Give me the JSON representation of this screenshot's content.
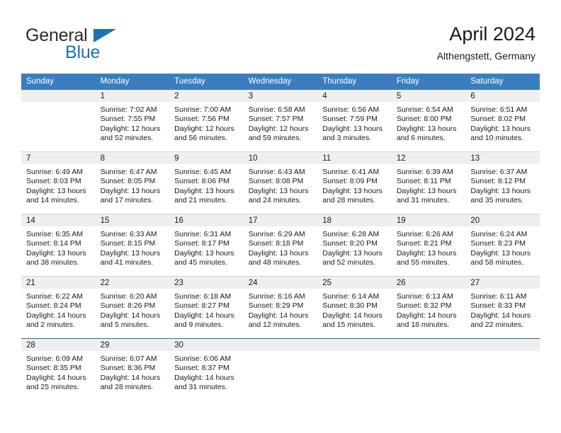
{
  "logo": {
    "word_one": "General",
    "word_two": "Blue",
    "triangle_color": "#1a71b8"
  },
  "header": {
    "month_title": "April 2024",
    "location": "Althengstett, Germany"
  },
  "theme": {
    "header_blue": "#3a7ebf",
    "band_gray": "#efefef",
    "separator_gray": "#d2d2d2",
    "separator_blue": "#2a6ca8"
  },
  "weekday_headers": [
    "Sunday",
    "Monday",
    "Tuesday",
    "Wednesday",
    "Thursday",
    "Friday",
    "Saturday"
  ],
  "weeks": [
    [
      {
        "day": "",
        "sunrise": "",
        "sunset": "",
        "daylight_line1": "",
        "daylight_line2": "",
        "empty": true
      },
      {
        "day": "1",
        "sunrise": "Sunrise: 7:02 AM",
        "sunset": "Sunset: 7:55 PM",
        "daylight_line1": "Daylight: 12 hours",
        "daylight_line2": "and 52 minutes."
      },
      {
        "day": "2",
        "sunrise": "Sunrise: 7:00 AM",
        "sunset": "Sunset: 7:56 PM",
        "daylight_line1": "Daylight: 12 hours",
        "daylight_line2": "and 56 minutes."
      },
      {
        "day": "3",
        "sunrise": "Sunrise: 6:58 AM",
        "sunset": "Sunset: 7:57 PM",
        "daylight_line1": "Daylight: 12 hours",
        "daylight_line2": "and 59 minutes."
      },
      {
        "day": "4",
        "sunrise": "Sunrise: 6:56 AM",
        "sunset": "Sunset: 7:59 PM",
        "daylight_line1": "Daylight: 13 hours",
        "daylight_line2": "and 3 minutes."
      },
      {
        "day": "5",
        "sunrise": "Sunrise: 6:54 AM",
        "sunset": "Sunset: 8:00 PM",
        "daylight_line1": "Daylight: 13 hours",
        "daylight_line2": "and 6 minutes."
      },
      {
        "day": "6",
        "sunrise": "Sunrise: 6:51 AM",
        "sunset": "Sunset: 8:02 PM",
        "daylight_line1": "Daylight: 13 hours",
        "daylight_line2": "and 10 minutes."
      }
    ],
    [
      {
        "day": "7",
        "sunrise": "Sunrise: 6:49 AM",
        "sunset": "Sunset: 8:03 PM",
        "daylight_line1": "Daylight: 13 hours",
        "daylight_line2": "and 14 minutes."
      },
      {
        "day": "8",
        "sunrise": "Sunrise: 6:47 AM",
        "sunset": "Sunset: 8:05 PM",
        "daylight_line1": "Daylight: 13 hours",
        "daylight_line2": "and 17 minutes."
      },
      {
        "day": "9",
        "sunrise": "Sunrise: 6:45 AM",
        "sunset": "Sunset: 8:06 PM",
        "daylight_line1": "Daylight: 13 hours",
        "daylight_line2": "and 21 minutes."
      },
      {
        "day": "10",
        "sunrise": "Sunrise: 6:43 AM",
        "sunset": "Sunset: 8:08 PM",
        "daylight_line1": "Daylight: 13 hours",
        "daylight_line2": "and 24 minutes."
      },
      {
        "day": "11",
        "sunrise": "Sunrise: 6:41 AM",
        "sunset": "Sunset: 8:09 PM",
        "daylight_line1": "Daylight: 13 hours",
        "daylight_line2": "and 28 minutes."
      },
      {
        "day": "12",
        "sunrise": "Sunrise: 6:39 AM",
        "sunset": "Sunset: 8:11 PM",
        "daylight_line1": "Daylight: 13 hours",
        "daylight_line2": "and 31 minutes."
      },
      {
        "day": "13",
        "sunrise": "Sunrise: 6:37 AM",
        "sunset": "Sunset: 8:12 PM",
        "daylight_line1": "Daylight: 13 hours",
        "daylight_line2": "and 35 minutes."
      }
    ],
    [
      {
        "day": "14",
        "sunrise": "Sunrise: 6:35 AM",
        "sunset": "Sunset: 8:14 PM",
        "daylight_line1": "Daylight: 13 hours",
        "daylight_line2": "and 38 minutes."
      },
      {
        "day": "15",
        "sunrise": "Sunrise: 6:33 AM",
        "sunset": "Sunset: 8:15 PM",
        "daylight_line1": "Daylight: 13 hours",
        "daylight_line2": "and 41 minutes."
      },
      {
        "day": "16",
        "sunrise": "Sunrise: 6:31 AM",
        "sunset": "Sunset: 8:17 PM",
        "daylight_line1": "Daylight: 13 hours",
        "daylight_line2": "and 45 minutes."
      },
      {
        "day": "17",
        "sunrise": "Sunrise: 6:29 AM",
        "sunset": "Sunset: 8:18 PM",
        "daylight_line1": "Daylight: 13 hours",
        "daylight_line2": "and 48 minutes."
      },
      {
        "day": "18",
        "sunrise": "Sunrise: 6:28 AM",
        "sunset": "Sunset: 8:20 PM",
        "daylight_line1": "Daylight: 13 hours",
        "daylight_line2": "and 52 minutes."
      },
      {
        "day": "19",
        "sunrise": "Sunrise: 6:26 AM",
        "sunset": "Sunset: 8:21 PM",
        "daylight_line1": "Daylight: 13 hours",
        "daylight_line2": "and 55 minutes."
      },
      {
        "day": "20",
        "sunrise": "Sunrise: 6:24 AM",
        "sunset": "Sunset: 8:23 PM",
        "daylight_line1": "Daylight: 13 hours",
        "daylight_line2": "and 58 minutes."
      }
    ],
    [
      {
        "day": "21",
        "sunrise": "Sunrise: 6:22 AM",
        "sunset": "Sunset: 8:24 PM",
        "daylight_line1": "Daylight: 14 hours",
        "daylight_line2": "and 2 minutes."
      },
      {
        "day": "22",
        "sunrise": "Sunrise: 6:20 AM",
        "sunset": "Sunset: 8:26 PM",
        "daylight_line1": "Daylight: 14 hours",
        "daylight_line2": "and 5 minutes."
      },
      {
        "day": "23",
        "sunrise": "Sunrise: 6:18 AM",
        "sunset": "Sunset: 8:27 PM",
        "daylight_line1": "Daylight: 14 hours",
        "daylight_line2": "and 9 minutes."
      },
      {
        "day": "24",
        "sunrise": "Sunrise: 6:16 AM",
        "sunset": "Sunset: 8:29 PM",
        "daylight_line1": "Daylight: 14 hours",
        "daylight_line2": "and 12 minutes."
      },
      {
        "day": "25",
        "sunrise": "Sunrise: 6:14 AM",
        "sunset": "Sunset: 8:30 PM",
        "daylight_line1": "Daylight: 14 hours",
        "daylight_line2": "and 15 minutes."
      },
      {
        "day": "26",
        "sunrise": "Sunrise: 6:13 AM",
        "sunset": "Sunset: 8:32 PM",
        "daylight_line1": "Daylight: 14 hours",
        "daylight_line2": "and 18 minutes."
      },
      {
        "day": "27",
        "sunrise": "Sunrise: 6:11 AM",
        "sunset": "Sunset: 8:33 PM",
        "daylight_line1": "Daylight: 14 hours",
        "daylight_line2": "and 22 minutes."
      }
    ],
    [
      {
        "day": "28",
        "sunrise": "Sunrise: 6:09 AM",
        "sunset": "Sunset: 8:35 PM",
        "daylight_line1": "Daylight: 14 hours",
        "daylight_line2": "and 25 minutes."
      },
      {
        "day": "29",
        "sunrise": "Sunrise: 6:07 AM",
        "sunset": "Sunset: 8:36 PM",
        "daylight_line1": "Daylight: 14 hours",
        "daylight_line2": "and 28 minutes."
      },
      {
        "day": "30",
        "sunrise": "Sunrise: 6:06 AM",
        "sunset": "Sunset: 8:37 PM",
        "daylight_line1": "Daylight: 14 hours",
        "daylight_line2": "and 31 minutes."
      },
      {
        "day": "",
        "sunrise": "",
        "sunset": "",
        "daylight_line1": "",
        "daylight_line2": "",
        "empty": true
      },
      {
        "day": "",
        "sunrise": "",
        "sunset": "",
        "daylight_line1": "",
        "daylight_line2": "",
        "empty": true
      },
      {
        "day": "",
        "sunrise": "",
        "sunset": "",
        "daylight_line1": "",
        "daylight_line2": "",
        "empty": true
      },
      {
        "day": "",
        "sunrise": "",
        "sunset": "",
        "daylight_line1": "",
        "daylight_line2": "",
        "empty": true
      }
    ]
  ]
}
